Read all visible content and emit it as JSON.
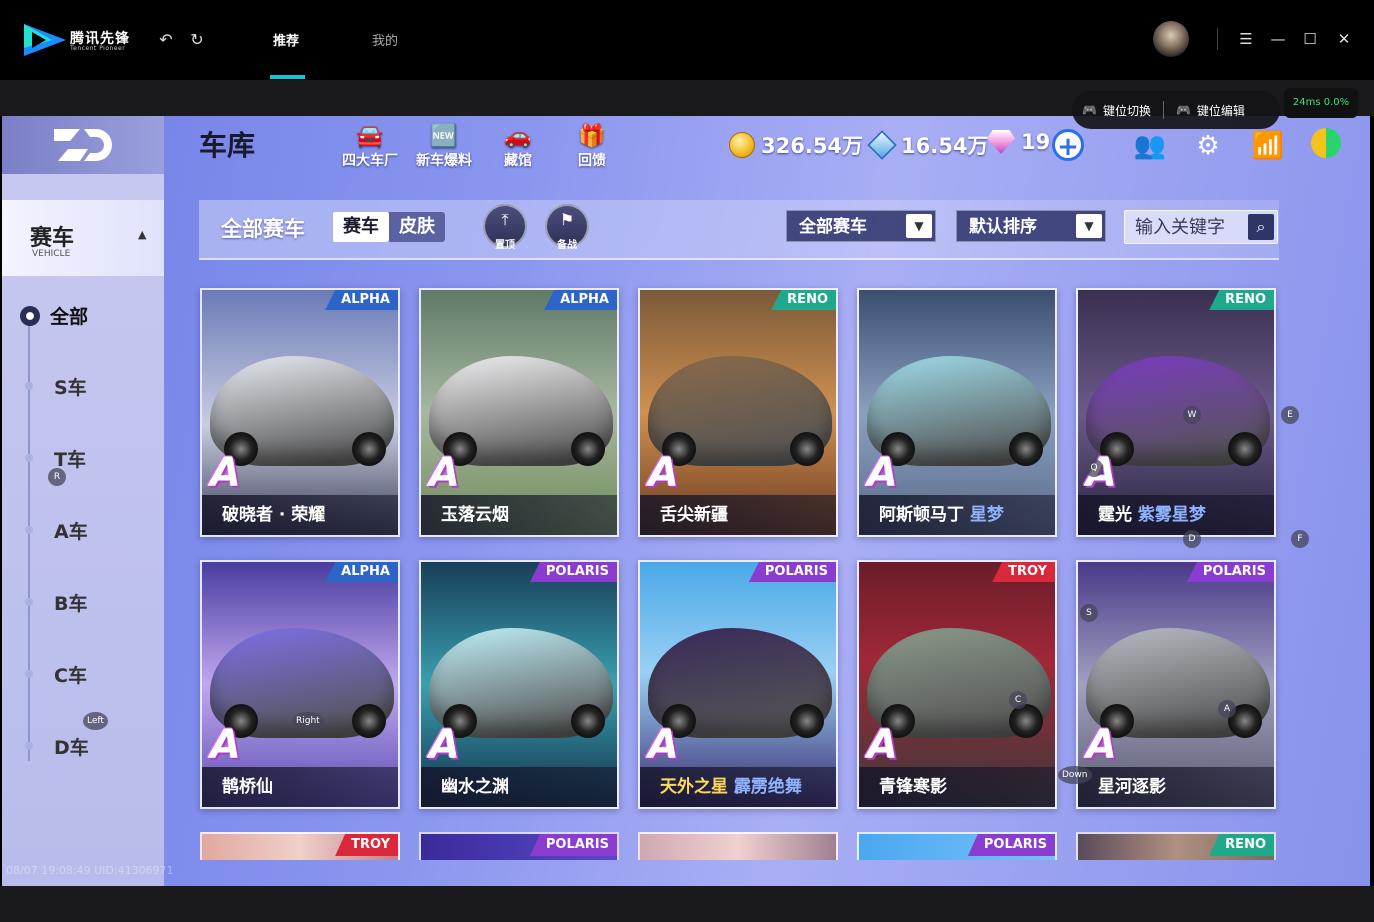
{
  "app": {
    "name": "腾讯先锋",
    "subname": "Tencent Pioneer"
  },
  "titlebar": {
    "tabs": [
      {
        "label": "推荐",
        "active": true
      },
      {
        "label": "我的",
        "active": false
      }
    ],
    "icons": [
      "undo-icon",
      "refresh-icon",
      "menu-icon",
      "minimize-icon",
      "maximize-icon",
      "close-icon"
    ]
  },
  "keybar": {
    "switch_label": "键位切换",
    "edit_label": "键位编辑",
    "ping": "24ms",
    "loss": "0.0%"
  },
  "header": {
    "title": "车库",
    "nav": [
      {
        "label": "四大车厂",
        "icon": "factory-car-icon"
      },
      {
        "label": "新车爆料",
        "icon": "new-badge-icon"
      },
      {
        "label": "藏馆",
        "icon": "garage-car-icon"
      },
      {
        "label": "回馈",
        "icon": "gift-box-icon"
      }
    ],
    "currency": {
      "coins": "326.54万",
      "vouchers": "16.54万",
      "diamonds": "19"
    }
  },
  "sidebar": {
    "category": {
      "label": "赛车",
      "sub": "VEHICLE"
    },
    "items": [
      "全部",
      "S车",
      "T车",
      "A车",
      "B车",
      "C车",
      "D车"
    ]
  },
  "filterbar": {
    "title": "全部赛车",
    "segments": [
      "赛车",
      "皮肤"
    ],
    "pin_label": "置顶",
    "ready_label": "备战",
    "filter_dropdown": "全部赛车",
    "sort_dropdown": "默认排序",
    "search_placeholder": "输入关键字"
  },
  "cards": [
    {
      "name": "破晓者 · 荣耀",
      "skin": "",
      "badge": "ALPHA",
      "badge_color": "#2c64c8",
      "grade": "A"
    },
    {
      "name": "玉落云烟",
      "skin": "",
      "badge": "ALPHA",
      "badge_color": "#2c64c8",
      "grade": "A"
    },
    {
      "name": "舌尖新疆",
      "skin": "",
      "badge": "RENO",
      "badge_color": "#1fa98a",
      "grade": "A"
    },
    {
      "name": "阿斯顿马丁",
      "skin": "星梦",
      "badge": "",
      "badge_color": "",
      "grade": "A"
    },
    {
      "name": "霆光",
      "skin": "紫雾星梦",
      "badge": "RENO",
      "badge_color": "#1fa98a",
      "grade": "A"
    },
    {
      "name": "鹊桥仙",
      "skin": "",
      "badge": "ALPHA",
      "badge_color": "#2c64c8",
      "grade": "A"
    },
    {
      "name": "幽水之渊",
      "skin": "",
      "badge": "POLARIS",
      "badge_color": "#8a3cd0",
      "grade": "A"
    },
    {
      "name": "天外之星",
      "skin": "霹雳绝舞",
      "badge": "POLARIS",
      "badge_color": "#8a3cd0",
      "grade": "A"
    },
    {
      "name": "青锋寒影",
      "skin": "",
      "badge": "TROY",
      "badge_color": "#d8283a",
      "grade": "A"
    },
    {
      "name": "星河逐影",
      "skin": "",
      "badge": "POLARIS",
      "badge_color": "#8a3cd0",
      "grade": "A"
    }
  ],
  "partial_cards": [
    {
      "badge": "TROY",
      "badge_color": "#d8283a"
    },
    {
      "badge": "POLARIS",
      "badge_color": "#8a3cd0"
    },
    {
      "badge": "",
      "badge_color": ""
    },
    {
      "badge": "POLARIS",
      "badge_color": "#8a3cd0"
    },
    {
      "badge": "RENO",
      "badge_color": "#1fa98a"
    }
  ],
  "hud_keys": [
    "R",
    "Left",
    "Right",
    "Q",
    "W",
    "E",
    "D",
    "F",
    "S",
    "A",
    "C",
    "Down"
  ],
  "uid_text": "08/07 19:08:49 UID:41306971"
}
